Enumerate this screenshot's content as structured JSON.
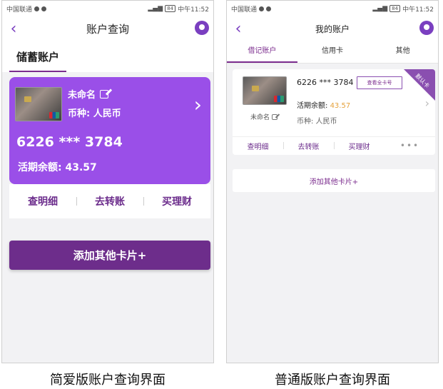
{
  "statusbar": {
    "carrier": "中国联通",
    "time": "中午11:52",
    "battery": "84"
  },
  "left": {
    "title": "账户查询",
    "tab": "储蓄账户",
    "card": {
      "name": "未命名",
      "currency": "币种: 人民币",
      "number": "6226 *** 3784",
      "balance": "活期余额: 43.57"
    },
    "actions": [
      "查明细",
      "去转账",
      "买理财"
    ],
    "add_button": "添加其他卡片+"
  },
  "right": {
    "title": "我的账户",
    "tabs": [
      "借记账户",
      "信用卡",
      "其他"
    ],
    "card": {
      "number": "6226 *** 3784",
      "view_full": "查看全卡号",
      "badge": "默认卡",
      "name": "未命名",
      "balance_label": "活期余额: ",
      "balance_amount": "43.57",
      "currency": "币种: 人民币"
    },
    "actions": [
      "查明细",
      "去转账",
      "买理财"
    ],
    "more": "•••",
    "add_button": "添加其他卡片+"
  },
  "captions": {
    "left": "简爱版账户查询界面",
    "right": "普通版账户查询界面"
  },
  "colors": {
    "purple": "#9a4fe8",
    "dark_purple": "#6d2d8b",
    "amount_orange": "#e6a23c"
  }
}
